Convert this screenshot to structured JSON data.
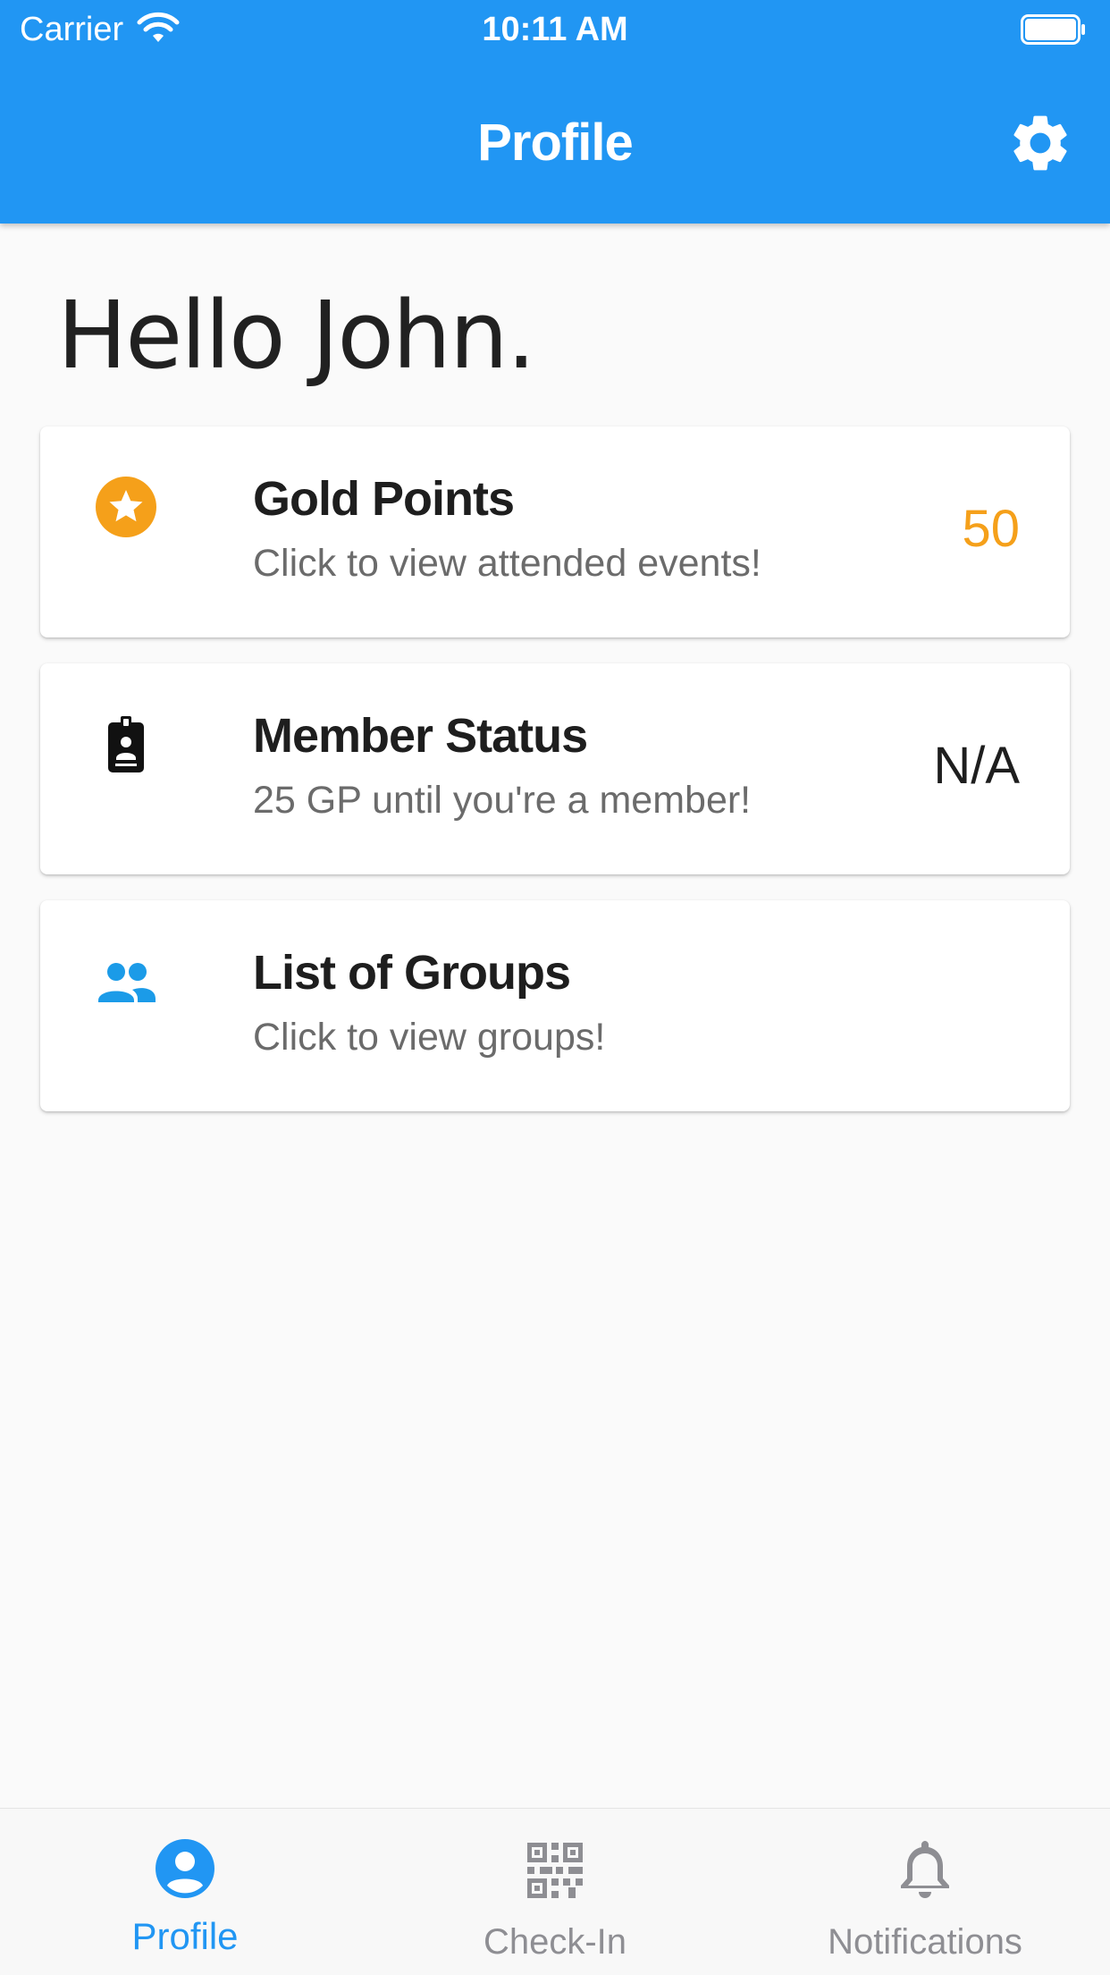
{
  "status_bar": {
    "carrier": "Carrier",
    "time": "10:11 AM"
  },
  "header": {
    "title": "Profile",
    "settings_icon": "gear-icon"
  },
  "greeting": "Hello John.",
  "cards": [
    {
      "icon": "star-circle-icon",
      "title": "Gold Points",
      "subtitle": "Click to view attended events!",
      "value": "50",
      "value_color": "#f5a01a"
    },
    {
      "icon": "id-badge-icon",
      "title": "Member Status",
      "subtitle": "25 GP until you're a member!",
      "value": "N/A",
      "value_color": "#1e1e1e"
    },
    {
      "icon": "group-icon",
      "title": "List of Groups",
      "subtitle": "Click to view groups!",
      "value": ""
    }
  ],
  "tabs": [
    {
      "label": "Profile",
      "icon": "account-circle-icon",
      "active": true
    },
    {
      "label": "Check-In",
      "icon": "qr-code-icon",
      "active": false
    },
    {
      "label": "Notifications",
      "icon": "bell-icon",
      "active": false
    }
  ],
  "colors": {
    "primary": "#2196f3",
    "gold": "#f5a01a",
    "group_icon": "#1b9be8",
    "tab_active": "#2196f3",
    "tab_inactive": "#8e8e93"
  }
}
